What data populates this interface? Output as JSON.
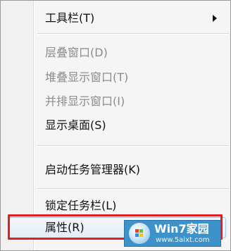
{
  "context_menu": {
    "items": [
      {
        "label": "工具栏(T)",
        "enabled": true,
        "has_submenu": true
      },
      {
        "label": "层叠窗口(D)",
        "enabled": false
      },
      {
        "label": "堆叠显示窗口(T)",
        "enabled": false
      },
      {
        "label": "并排显示窗口(I)",
        "enabled": false
      },
      {
        "label": "显示桌面(S)",
        "enabled": true
      },
      {
        "label": "启动任务管理器(K)",
        "enabled": true
      },
      {
        "label": "锁定任务栏(L)",
        "enabled": true
      },
      {
        "label": "属性(R)",
        "enabled": true,
        "hovered": true
      }
    ]
  },
  "highlight": {
    "color": "#e02020",
    "target": "属性(R)"
  },
  "watermark": {
    "title": "Win7家园",
    "url": "www.5aixt.com",
    "color": "#3d93c9"
  }
}
